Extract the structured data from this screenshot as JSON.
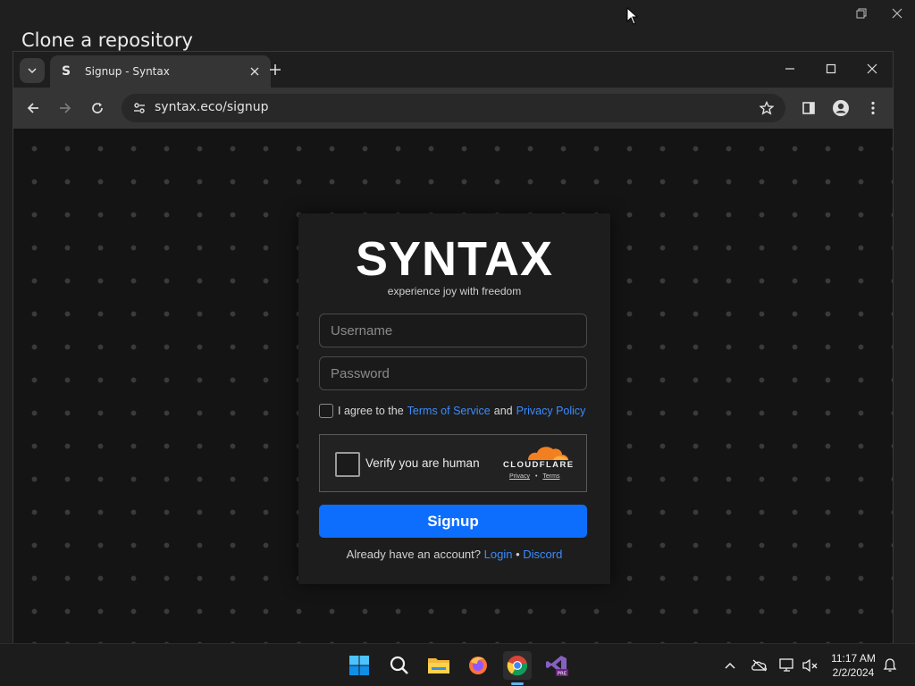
{
  "background_app": {
    "title": "Clone a repository"
  },
  "browser": {
    "tab": {
      "favicon_letter": "S",
      "title": "Signup - Syntax"
    },
    "url": "syntax.eco/signup"
  },
  "page": {
    "logo": "SYNTAX",
    "tagline": "experience joy with freedom",
    "username_placeholder": "Username",
    "password_placeholder": "Password",
    "agree_prefix": "I agree to the",
    "terms_link": "Terms of Service",
    "agree_and": "and",
    "privacy_link": "Privacy Policy",
    "captcha": {
      "label": "Verify you are human",
      "brand": "CLOUDFLARE",
      "privacy": "Privacy",
      "separator": "•",
      "terms": "Terms"
    },
    "signup_button": "Signup",
    "already_text": "Already have an account?",
    "login_link": "Login",
    "bullet": "•",
    "discord_link": "Discord"
  },
  "colors": {
    "accent": "#0d6efd",
    "link": "#3b8cff",
    "cloudflare_orange": "#f38020"
  },
  "taskbar": {
    "apps": [
      "start-icon",
      "search-icon",
      "file-explorer-icon",
      "firefox-icon",
      "chrome-icon",
      "visual-studio-icon"
    ],
    "clock_time": "11:17 AM",
    "clock_date": "2/2/2024"
  }
}
